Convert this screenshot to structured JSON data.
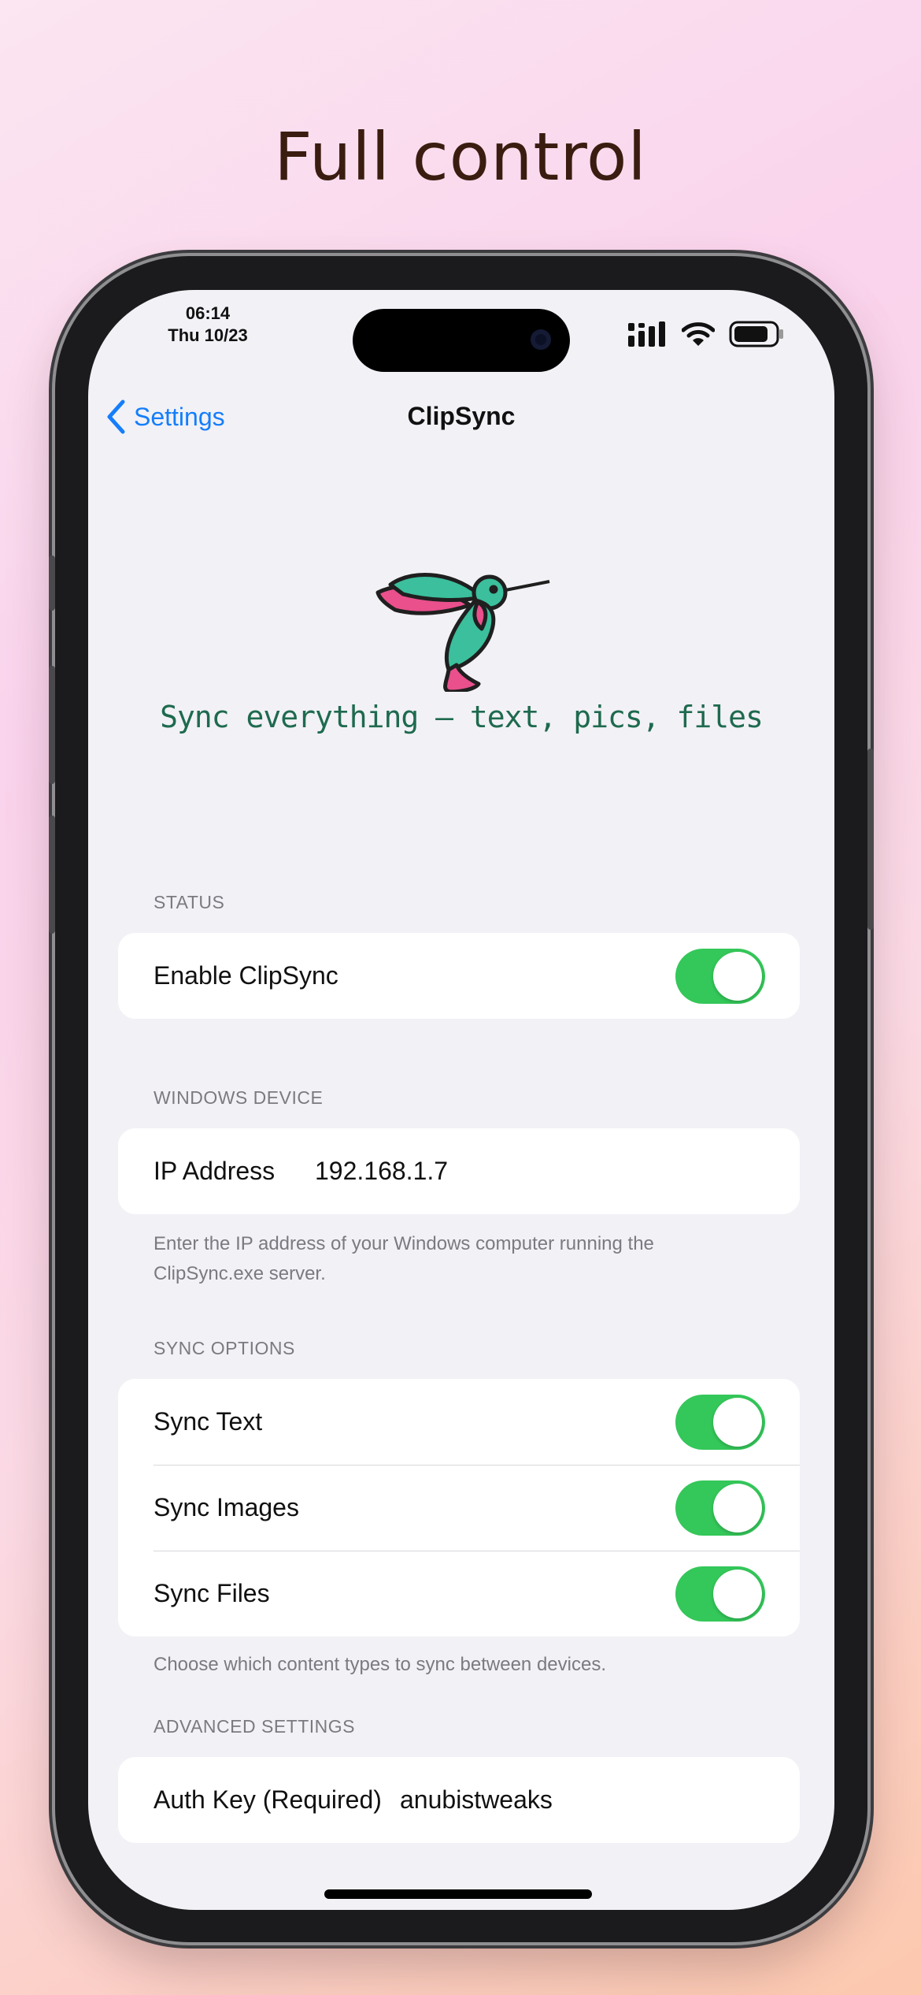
{
  "promo": {
    "headline": "Full control"
  },
  "status_bar": {
    "time": "06:14",
    "date": "Thu 10/23"
  },
  "nav": {
    "back_label": "Settings",
    "title": "ClipSync"
  },
  "hero": {
    "tagline": "Sync everything – text, pics, files",
    "logo_icon": "hummingbird-icon"
  },
  "sections": {
    "status": {
      "header": "STATUS",
      "rows": [
        {
          "label": "Enable ClipSync",
          "toggle_on": true
        }
      ]
    },
    "windows_device": {
      "header": "WINDOWS DEVICE",
      "ip_label": "IP Address",
      "ip_value": "192.168.1.7",
      "footer": "Enter the IP address of your Windows computer running the ClipSync.exe server."
    },
    "sync_options": {
      "header": "SYNC OPTIONS",
      "rows": [
        {
          "label": "Sync Text",
          "toggle_on": true
        },
        {
          "label": "Sync Images",
          "toggle_on": true
        },
        {
          "label": "Sync Files",
          "toggle_on": true
        }
      ],
      "footer": "Choose which content types to sync between devices."
    },
    "advanced": {
      "header": "ADVANCED SETTINGS",
      "auth_label": "Auth Key (Required)",
      "auth_value": "anubistweaks"
    }
  },
  "colors": {
    "accent": "#147efb",
    "toggle_on": "#34c759",
    "tagline": "#1e6a4e",
    "background": "#f2f1f6"
  }
}
